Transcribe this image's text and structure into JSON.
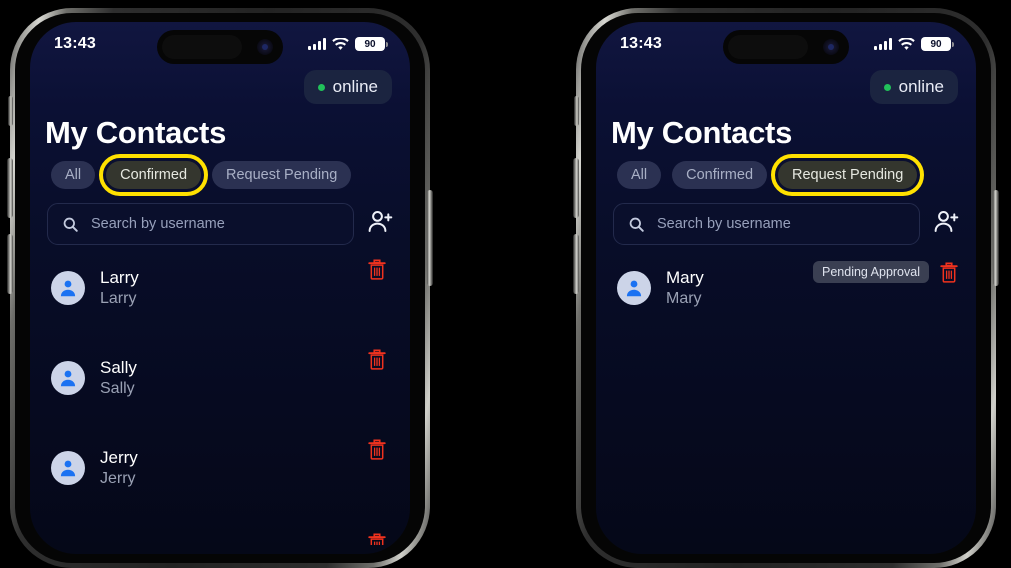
{
  "phones": [
    {
      "id": "left",
      "status_bar": {
        "time": "13:43",
        "battery": "90",
        "signal_icon": "cellular-signal-icon",
        "wifi_icon": "wifi-icon",
        "battery_icon": "battery-icon"
      },
      "presence": {
        "label": "online",
        "dot_color": "#21c15a"
      },
      "page_title": "My Contacts",
      "tabs": [
        {
          "label": "All",
          "selected": false,
          "highlighted": false
        },
        {
          "label": "Confirmed",
          "selected": true,
          "highlighted": true
        },
        {
          "label": "Request Pending",
          "selected": false,
          "highlighted": false
        }
      ],
      "search": {
        "placeholder": "Search by username",
        "value": "",
        "icon": "search-icon"
      },
      "add_contact_icon": "add-user-icon",
      "contacts": [
        {
          "name": "Larry",
          "username": "Larry",
          "badge": "",
          "delete_icon": "trash-icon"
        },
        {
          "name": "Sally",
          "username": "Sally",
          "badge": "",
          "delete_icon": "trash-icon"
        },
        {
          "name": "Jerry",
          "username": "Jerry",
          "badge": "",
          "delete_icon": "trash-icon"
        }
      ],
      "has_clipped_row": true
    },
    {
      "id": "right",
      "status_bar": {
        "time": "13:43",
        "battery": "90",
        "signal_icon": "cellular-signal-icon",
        "wifi_icon": "wifi-icon",
        "battery_icon": "battery-icon"
      },
      "presence": {
        "label": "online",
        "dot_color": "#21c15a"
      },
      "page_title": "My Contacts",
      "tabs": [
        {
          "label": "All",
          "selected": false,
          "highlighted": false
        },
        {
          "label": "Confirmed",
          "selected": false,
          "highlighted": false
        },
        {
          "label": "Request Pending",
          "selected": true,
          "highlighted": true
        }
      ],
      "search": {
        "placeholder": "Search by username",
        "value": "",
        "icon": "search-icon"
      },
      "add_contact_icon": "add-user-icon",
      "contacts": [
        {
          "name": "Mary",
          "username": "Mary",
          "badge": "Pending Approval",
          "delete_icon": "trash-icon"
        }
      ],
      "has_clipped_row": false
    }
  ],
  "colors": {
    "screen_top": "#111640",
    "screen_bottom": "#050818",
    "highlight_ring": "#FFE100",
    "selected_tab_bg": "#34362e",
    "tab_bg": "#2b3152",
    "trash": "#f0321e",
    "avatar_bg": "#ccd4e8",
    "avatar_glyph": "#1b72f2",
    "badge_bg": "#3a3f52"
  }
}
